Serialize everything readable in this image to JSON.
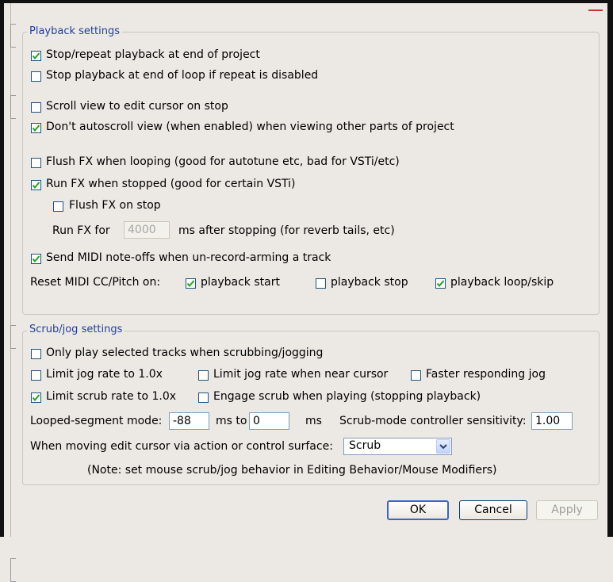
{
  "playback": {
    "legend": "Playback settings",
    "stop_repeat_end": {
      "label": "Stop/repeat playback at end of project",
      "checked": true
    },
    "stop_end_loop": {
      "label": "Stop playback at end of loop if repeat is disabled",
      "checked": false
    },
    "scroll_view_edit": {
      "label": "Scroll view to edit cursor on stop",
      "checked": false
    },
    "dont_autoscroll": {
      "label": "Don't autoscroll view (when enabled) when viewing other parts of project",
      "checked": true
    },
    "flush_fx_looping": {
      "label": "Flush FX when looping (good for autotune etc, bad for VSTi/etc)",
      "checked": false
    },
    "run_fx_stopped": {
      "label": "Run FX when stopped (good for certain VSTi)",
      "checked": true
    },
    "flush_fx_stop": {
      "label": "Flush FX on stop",
      "checked": false
    },
    "run_fx_for_label": "Run FX for",
    "run_fx_for_value": "4000",
    "run_fx_for_suffix": "ms after stopping (for reverb tails, etc)",
    "send_midi_noteoffs": {
      "label": "Send MIDI note-offs when un-record-arming a track",
      "checked": true
    },
    "reset_midi_label": "Reset MIDI CC/Pitch on:",
    "reset_playback_start": {
      "label": "playback start",
      "checked": true
    },
    "reset_playback_stop": {
      "label": "playback stop",
      "checked": false
    },
    "reset_playback_loop": {
      "label": "playback loop/skip",
      "checked": true
    }
  },
  "scrub": {
    "legend": "Scrub/jog settings",
    "only_selected": {
      "label": "Only play selected tracks when scrubbing/jogging",
      "checked": false
    },
    "limit_jog_rate": {
      "label": "Limit jog rate to 1.0x",
      "checked": false
    },
    "limit_jog_near": {
      "label": "Limit jog rate when near cursor",
      "checked": false
    },
    "faster_jog": {
      "label": "Faster responding jog",
      "checked": false
    },
    "limit_scrub_rate": {
      "label": "Limit scrub rate to 1.0x",
      "checked": true
    },
    "engage_scrub": {
      "label": "Engage scrub when playing (stopping playback)",
      "checked": false
    },
    "looped_mode_label": "Looped-segment mode:",
    "looped_from": "-88",
    "ms_to_label": "ms to",
    "looped_to": "0",
    "ms_label": "ms",
    "sensitivity_label": "Scrub-mode controller sensitivity:",
    "sensitivity_value": "1.00",
    "moving_edit_label": "When moving edit cursor via action or control surface:",
    "moving_edit_value": "Scrub",
    "note": "(Note: set mouse scrub/jog behavior in Editing Behavior/Mouse Modifiers)"
  },
  "buttons": {
    "ok": "OK",
    "cancel": "Cancel",
    "apply": "Apply"
  },
  "colors": {
    "legend": "#1f3f9c",
    "checkbox_border": "#1c5180",
    "check_mark": "#21a121"
  }
}
